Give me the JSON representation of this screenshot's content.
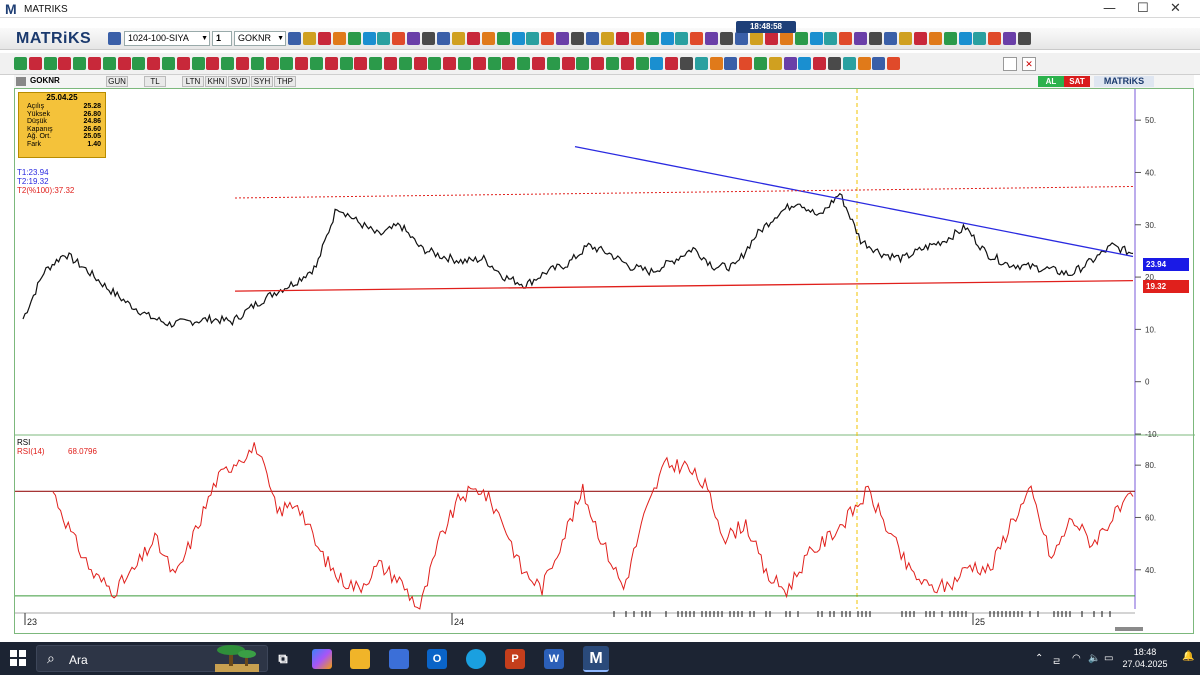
{
  "window": {
    "logo": "M",
    "title": "MATRIKS",
    "clock": "18:48:58",
    "min": "—",
    "max": "☐",
    "close": "✕"
  },
  "toolbar": {
    "brand": "MATRiKS",
    "template": "1024-100-SIYA",
    "layout": "1",
    "symbol": "GOKNR"
  },
  "tabs": {
    "symbol": "GOKNR",
    "items": [
      "GUN",
      "TL",
      "LTN",
      "KHN",
      "SVD",
      "SYH",
      "THP"
    ],
    "al": "AL",
    "sat": "SAT",
    "brand": "MATRiKS"
  },
  "infobox": {
    "date": "25.04.25",
    "rows": [
      {
        "k": "Açılış",
        "v": "25.28"
      },
      {
        "k": "Yüksek",
        "v": "26.80"
      },
      {
        "k": "Düşük",
        "v": "24.86"
      },
      {
        "k": "Kapanış",
        "v": "26.60"
      },
      {
        "k": "Ağ. Ort.",
        "v": "25.05"
      },
      {
        "k": "Fark",
        "v": "1.40"
      }
    ]
  },
  "trend_labels": {
    "t1": "T1:23.94",
    "t2": "T2:19.32",
    "t2pct": "T2(%100):37.32"
  },
  "price_axis": {
    "ticks": [
      "50.",
      "40.",
      "30.",
      "20.",
      "10.",
      "0",
      "-10."
    ],
    "badge_blue": "23.94",
    "badge_red": "19.32"
  },
  "rsi": {
    "title": "RSI",
    "label": "RSI(14)",
    "value": "68.0796",
    "ticks": [
      "80.",
      "60.",
      "40."
    ]
  },
  "time_axis": {
    "labels": [
      "23",
      "24",
      "25"
    ]
  },
  "colors": {
    "price_line": "#111111",
    "trend_blue": "#2a2ae0",
    "trend_red": "#e0201c",
    "rsi_line": "#e0201c",
    "vertical_marker": "#f2c300",
    "accent_navy": "#1b3a6e"
  },
  "chart_data": [
    {
      "type": "line",
      "title": "GOKNR",
      "series": [
        {
          "name": "GOKNR",
          "values": [
            12.0,
            21.0,
            24.5,
            21.5,
            18.0,
            15.0,
            12.5,
            11.0,
            11.5,
            12.0,
            11.5,
            14.5,
            17.0,
            19.0,
            22.0,
            33.5,
            30.5,
            28.0,
            30.0,
            25.5,
            24.0,
            23.0,
            23.5,
            20.0,
            18.5,
            21.0,
            22.5,
            26.0,
            24.5,
            22.0,
            21.0,
            23.0,
            25.5,
            22.0,
            22.0,
            28.0,
            32.0,
            34.5,
            31.5,
            36.0,
            27.0,
            24.5,
            23.5,
            25.5,
            27.0,
            29.5,
            24.5,
            22.5,
            22.0,
            21.5,
            20.5,
            23.0,
            26.0,
            24.5
          ]
        }
      ],
      "ylim": [
        -10,
        55
      ],
      "xticks": [
        "23",
        "24",
        "25"
      ],
      "yticks": [
        50,
        40,
        30,
        20,
        10,
        0,
        -10
      ],
      "trend_lines": [
        {
          "name": "T1",
          "value": 23.94
        },
        {
          "name": "T2",
          "value": 19.32
        },
        {
          "name": "T2(%100)",
          "value": 37.32
        }
      ]
    },
    {
      "type": "line",
      "title": "RSI",
      "series": [
        {
          "name": "RSI(14)",
          "values": [
            70,
            52,
            38,
            32,
            40,
            52,
            37,
            55,
            74,
            82,
            87,
            62,
            66,
            48,
            37,
            33,
            42,
            36,
            25,
            52,
            68,
            71,
            60,
            40,
            33,
            52,
            70,
            50,
            33,
            60,
            80,
            80,
            72,
            52,
            58,
            38,
            32,
            45,
            52,
            60,
            70,
            55,
            40,
            33,
            34,
            42,
            40,
            58,
            70,
            44,
            60,
            50,
            60,
            68
          ]
        }
      ],
      "ylim": [
        25,
        90
      ],
      "yticks": [
        80,
        60,
        40
      ],
      "reference_lines": [
        70,
        30
      ]
    }
  ]
}
